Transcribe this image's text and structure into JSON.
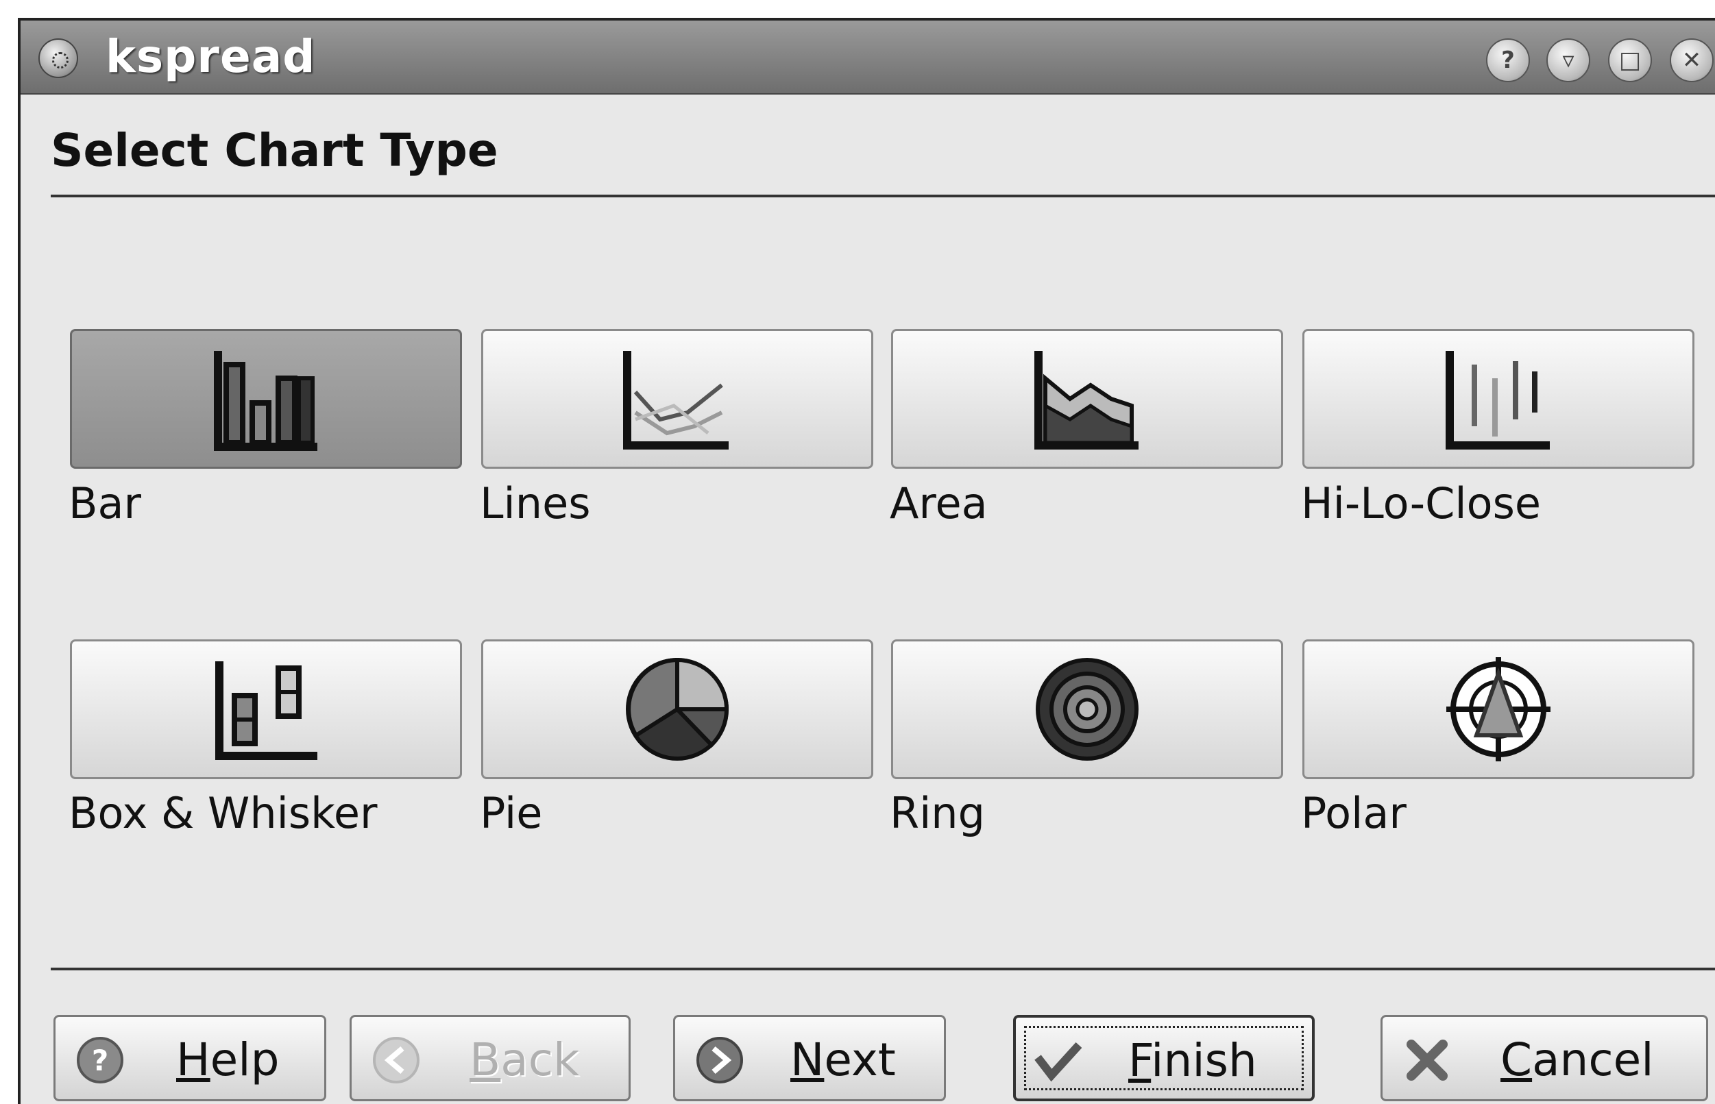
{
  "window": {
    "title": "kspread",
    "controls": [
      {
        "name": "help-window-button",
        "glyph": "?"
      },
      {
        "name": "minimize-button",
        "glyph": "▿"
      },
      {
        "name": "maximize-button",
        "glyph": "□"
      },
      {
        "name": "close-window-button",
        "glyph": "✕"
      }
    ]
  },
  "heading": "Select Chart Type",
  "chart_types": [
    {
      "label": "Bar",
      "icon": "bar-chart-icon",
      "selected": true
    },
    {
      "label": "Lines",
      "icon": "line-chart-icon",
      "selected": false
    },
    {
      "label": "Area",
      "icon": "area-chart-icon",
      "selected": false
    },
    {
      "label": "Hi-Lo-Close",
      "icon": "hi-lo-close-chart-icon",
      "selected": false
    },
    {
      "label": "Box & Whisker",
      "icon": "box-whisker-chart-icon",
      "selected": false
    },
    {
      "label": "Pie",
      "icon": "pie-chart-icon",
      "selected": false
    },
    {
      "label": "Ring",
      "icon": "ring-chart-icon",
      "selected": false
    },
    {
      "label": "Polar",
      "icon": "polar-chart-icon",
      "selected": false
    }
  ],
  "buttons": {
    "help": {
      "label": "Help",
      "icon": "question-icon"
    },
    "back": {
      "label": "Back",
      "icon": "arrow-left-icon",
      "enabled": false
    },
    "next": {
      "label": "Next",
      "icon": "arrow-right-icon"
    },
    "finish": {
      "label": "Finish",
      "icon": "checkmark-icon",
      "default": true
    },
    "cancel": {
      "label": "Cancel",
      "icon": "x-icon"
    }
  }
}
